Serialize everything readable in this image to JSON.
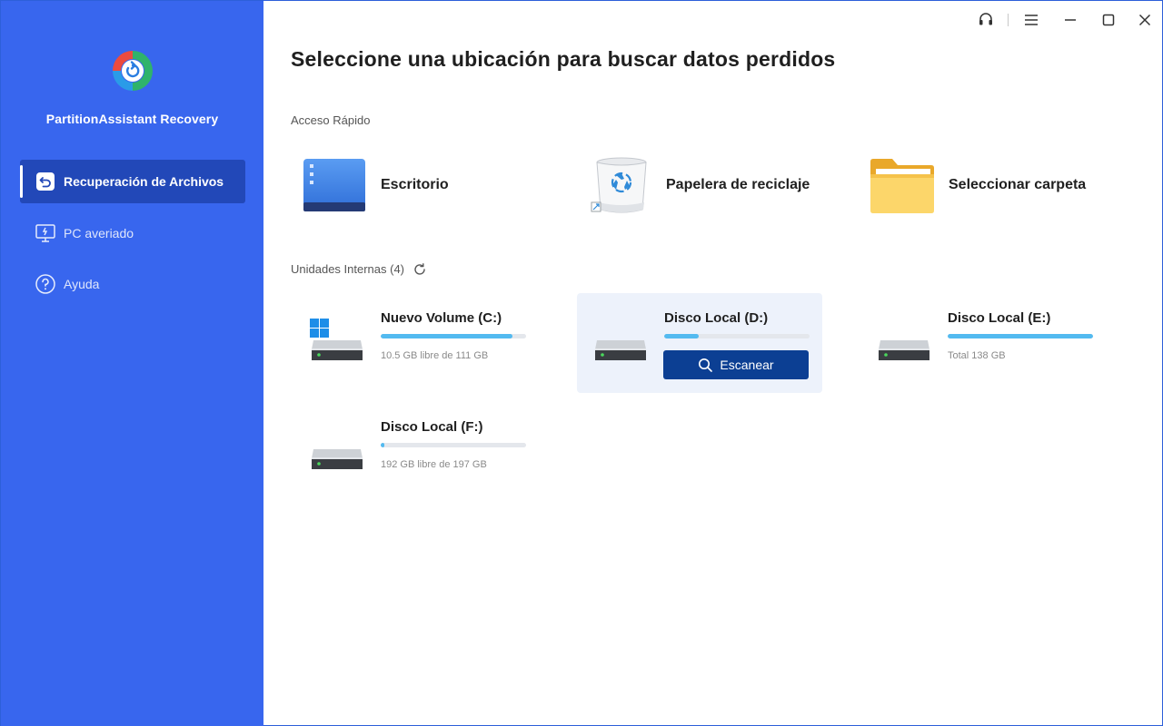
{
  "app": {
    "name": "PartitionAssistant Recovery"
  },
  "sidebar": {
    "items": [
      {
        "label": "Recuperación de Archivos",
        "icon": "file-recovery-icon",
        "active": true
      },
      {
        "label": "PC averiado",
        "icon": "crashed-pc-icon",
        "active": false
      },
      {
        "label": "Ayuda",
        "icon": "help-icon",
        "active": false
      }
    ]
  },
  "titlebar": {
    "icons": [
      "headset-icon",
      "menu-icon",
      "minimize-icon",
      "maximize-icon",
      "close-icon"
    ]
  },
  "main": {
    "title": "Seleccione una ubicación para buscar datos perdidos",
    "quick_access": {
      "label": "Acceso Rápido",
      "items": [
        {
          "label": "Escritorio",
          "icon": "desktop-icon"
        },
        {
          "label": "Papelera de reciclaje",
          "icon": "recycle-bin-icon"
        },
        {
          "label": "Seleccionar carpeta",
          "icon": "folder-icon"
        }
      ]
    },
    "drives": {
      "label": "Unidades Internas (4)",
      "items": [
        {
          "name": "Nuevo Volume (C:)",
          "info": "10.5 GB libre de 111 GB",
          "used_fraction": 0.905,
          "windows": true
        },
        {
          "name": "Disco Local (D:)",
          "info": "",
          "used_fraction": 0.24,
          "hovered": true,
          "scan_label": "Escanear"
        },
        {
          "name": "Disco Local (E:)",
          "info": "Total 138 GB",
          "used_fraction": 1.0
        },
        {
          "name": "Disco Local (F:)",
          "info": "192 GB libre de 197 GB",
          "used_fraction": 0.025
        }
      ]
    }
  },
  "colors": {
    "sidebar": "#3866ee",
    "sidebar_active": "#2248b8",
    "scan_button": "#0c3f93",
    "usage_bar": "#53baf0"
  }
}
